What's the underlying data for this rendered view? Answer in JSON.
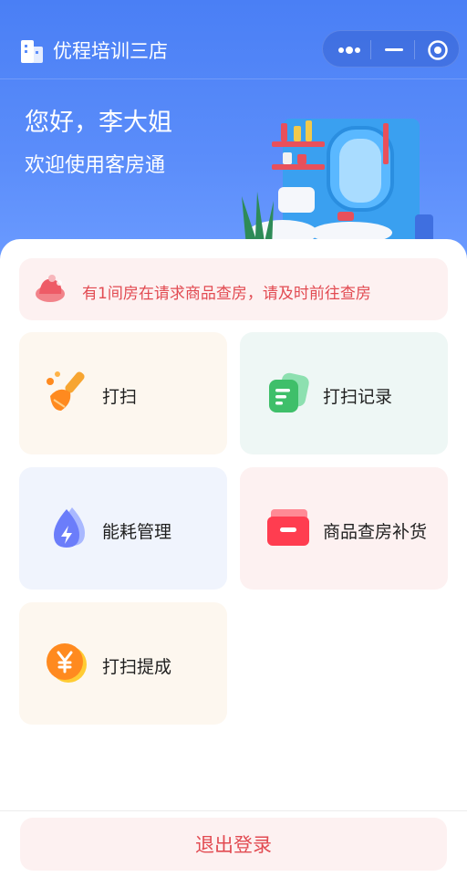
{
  "nav": {
    "title": "优程培训三店"
  },
  "greeting": {
    "hello": "您好，李大姐",
    "welcome": "欢迎使用客房通"
  },
  "notice": {
    "text": "有1间房在请求商品查房，请及时前往查房"
  },
  "menu": [
    {
      "label": "打扫",
      "icon": "broom-icon",
      "bg": "#fdf7ef"
    },
    {
      "label": "打扫记录",
      "icon": "records-icon",
      "bg": "#eef7f5"
    },
    {
      "label": "能耗管理",
      "icon": "energy-icon",
      "bg": "#f0f4fd"
    },
    {
      "label": "商品查房补货",
      "icon": "goods-box-icon",
      "bg": "#fdf1f1"
    },
    {
      "label": "打扫提成",
      "icon": "commission-icon",
      "bg": "#fdf7ef"
    }
  ],
  "logout": {
    "label": "退出登录"
  },
  "colors": {
    "brand": "#4a7ff5",
    "alert": "#e24b52"
  }
}
